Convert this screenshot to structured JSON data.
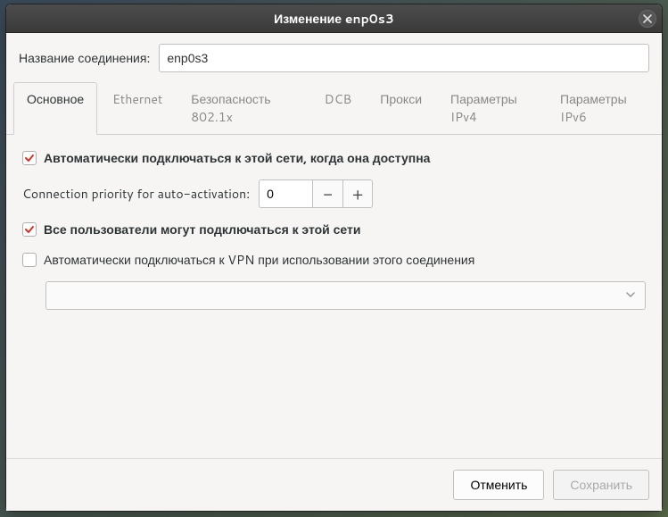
{
  "window": {
    "title": "Изменение enp0s3"
  },
  "name_row": {
    "label": "Название соединения:",
    "value": "enp0s3"
  },
  "tabs": [
    {
      "label": "Основное",
      "active": true
    },
    {
      "label": "Ethernet",
      "active": false
    },
    {
      "label": "Безопасность 802.1x",
      "active": false
    },
    {
      "label": "DCB",
      "active": false
    },
    {
      "label": "Прокси",
      "active": false
    },
    {
      "label": "Параметры IPv4",
      "active": false
    },
    {
      "label": "Параметры IPv6",
      "active": false
    }
  ],
  "general": {
    "autoconnect_label": "Автоматически подключаться к этой сети, когда она доступна",
    "autoconnect_checked": true,
    "priority_label": "Connection priority for auto-activation:",
    "priority_value": "0",
    "all_users_label": "Все пользователи могут подключаться к этой сети",
    "all_users_checked": true,
    "vpn_label": "Автоматически подключаться к VPN при использовании этого соединения",
    "vpn_checked": false,
    "vpn_selected": ""
  },
  "footer": {
    "cancel": "Отменить",
    "save": "Сохранить",
    "save_enabled": false
  }
}
